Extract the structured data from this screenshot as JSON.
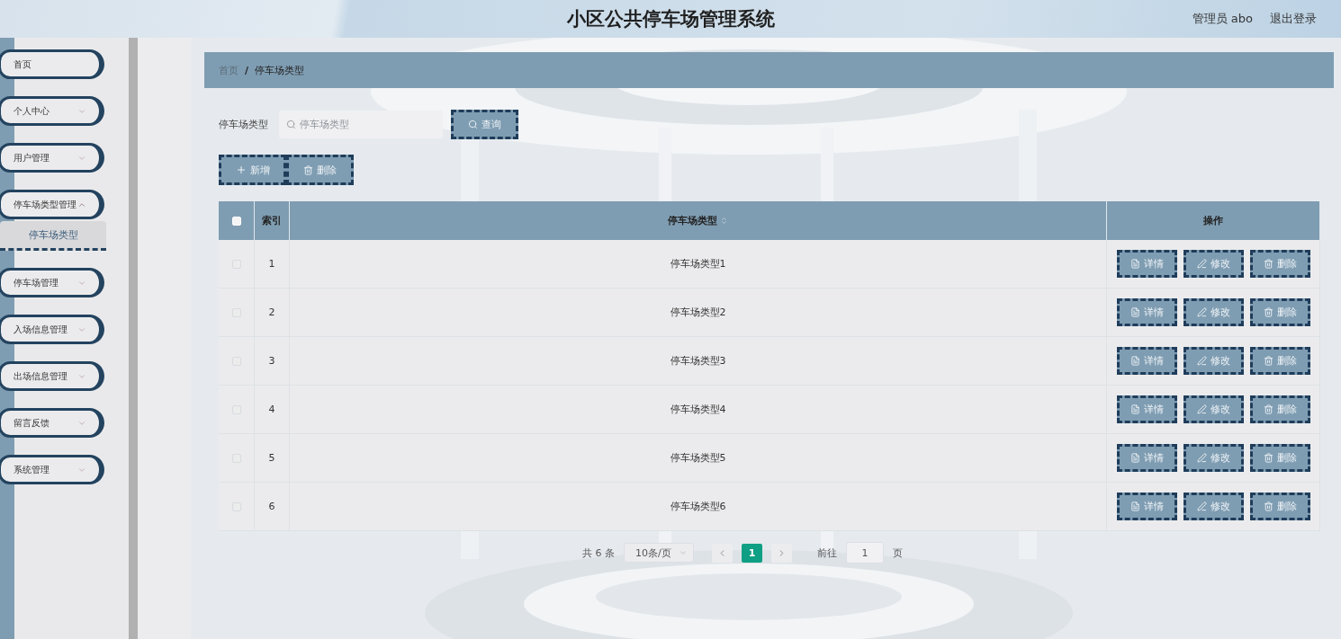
{
  "header": {
    "title": "小区公共停车场管理系统",
    "user": "管理员 abo",
    "logout": "退出登录"
  },
  "sidebar": {
    "items": [
      {
        "label": "首页",
        "expandable": false
      },
      {
        "label": "个人中心",
        "expandable": true,
        "expanded": false
      },
      {
        "label": "用户管理",
        "expandable": true,
        "expanded": false
      },
      {
        "label": "停车场类型管理",
        "expandable": true,
        "expanded": true,
        "children": [
          {
            "label": "停车场类型",
            "selected": true
          }
        ]
      },
      {
        "label": "停车场管理",
        "expandable": true,
        "expanded": false
      },
      {
        "label": "入场信息管理",
        "expandable": true,
        "expanded": false
      },
      {
        "label": "出场信息管理",
        "expandable": true,
        "expanded": false
      },
      {
        "label": "留言反馈",
        "expandable": true,
        "expanded": false
      },
      {
        "label": "系统管理",
        "expandable": true,
        "expanded": false
      }
    ]
  },
  "breadcrumb": {
    "items": [
      "首页",
      "停车场类型"
    ],
    "separator": "/"
  },
  "search": {
    "label": "停车场类型",
    "placeholder": "停车场类型",
    "button": "查询"
  },
  "actions": [
    {
      "label": "新增",
      "kind": "add"
    },
    {
      "label": "删除",
      "kind": "delete"
    }
  ],
  "table": {
    "select_all": {
      "checked": false
    },
    "columns": [
      {
        "label": "索引",
        "sortable": false
      },
      {
        "label": "停车场类型",
        "sortable": true
      },
      {
        "label": "操作",
        "sortable": false
      }
    ],
    "rows": [
      {
        "checked": false,
        "index": "1",
        "name": "停车场类型1",
        "actions": [
          {
            "label": "详情",
            "kind": "detail"
          },
          {
            "label": "修改",
            "kind": "edit"
          },
          {
            "label": "删除",
            "kind": "delete"
          }
        ]
      },
      {
        "checked": false,
        "index": "2",
        "name": "停车场类型2",
        "actions": [
          {
            "label": "详情",
            "kind": "detail"
          },
          {
            "label": "修改",
            "kind": "edit"
          },
          {
            "label": "删除",
            "kind": "delete"
          }
        ]
      },
      {
        "checked": false,
        "index": "3",
        "name": "停车场类型3",
        "actions": [
          {
            "label": "详情",
            "kind": "detail"
          },
          {
            "label": "修改",
            "kind": "edit"
          },
          {
            "label": "删除",
            "kind": "delete"
          }
        ]
      },
      {
        "checked": false,
        "index": "4",
        "name": "停车场类型4",
        "actions": [
          {
            "label": "详情",
            "kind": "detail"
          },
          {
            "label": "修改",
            "kind": "edit"
          },
          {
            "label": "删除",
            "kind": "delete"
          }
        ]
      },
      {
        "checked": false,
        "index": "5",
        "name": "停车场类型5",
        "actions": [
          {
            "label": "详情",
            "kind": "detail"
          },
          {
            "label": "修改",
            "kind": "edit"
          },
          {
            "label": "删除",
            "kind": "delete"
          }
        ]
      },
      {
        "checked": false,
        "index": "6",
        "name": "停车场类型6",
        "actions": [
          {
            "label": "详情",
            "kind": "detail"
          },
          {
            "label": "修改",
            "kind": "edit"
          },
          {
            "label": "删除",
            "kind": "delete"
          }
        ]
      }
    ]
  },
  "pagination": {
    "total": "共 6 条",
    "page_size": "10条/页",
    "pages": [
      {
        "label": "1",
        "selected": true
      }
    ],
    "goto_label": "前往",
    "goto_value": "1",
    "goto_suffix": "页"
  }
}
